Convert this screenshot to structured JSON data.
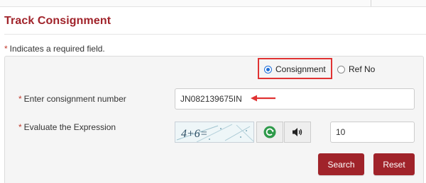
{
  "page": {
    "title": "Track Consignment",
    "required_star": "*",
    "required_note": "Indicates a required field."
  },
  "search_type": {
    "options": [
      {
        "label": "Consignment",
        "selected": true
      },
      {
        "label": "Ref No",
        "selected": false
      }
    ]
  },
  "form": {
    "consignment_label": "Enter consignment number",
    "consignment_value": "JN082139675IN",
    "expression_label": "Evaluate the Expression",
    "captcha_text": "4+6=",
    "answer_value": "10"
  },
  "buttons": {
    "search": "Search",
    "reset": "Reset"
  },
  "colors": {
    "brand": "#a0232a",
    "highlight": "#e03333",
    "refresh_icon": "#2e9a4a"
  },
  "icons": {
    "refresh": "refresh-icon",
    "audio": "speaker-icon"
  }
}
